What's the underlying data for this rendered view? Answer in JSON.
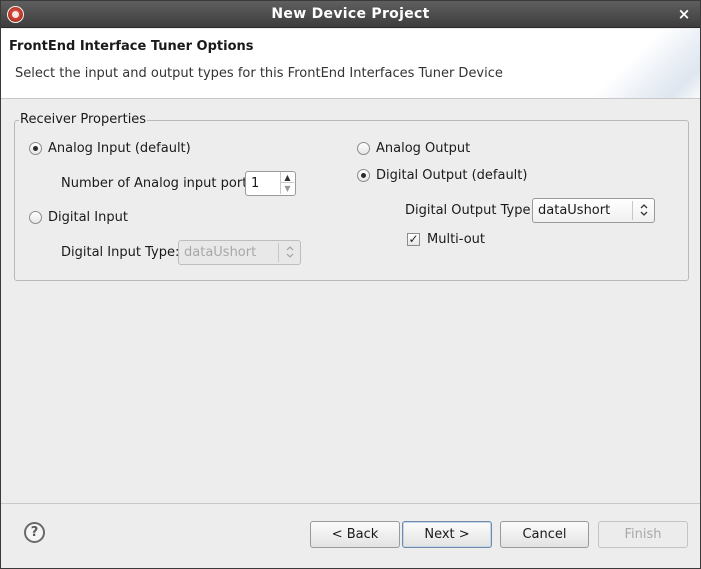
{
  "window": {
    "title": "New Device Project",
    "close_glyph": "×"
  },
  "banner": {
    "title": "FrontEnd Interface Tuner Options",
    "description": "Select the input and output types for this FrontEnd Interfaces Tuner Device"
  },
  "receiver": {
    "legend": "Receiver Properties",
    "analog_input": {
      "label": "Analog Input (default)",
      "selected": true
    },
    "num_analog_ports": {
      "label": "Number of Analog input ports:",
      "value": "1"
    },
    "digital_input": {
      "label": "Digital Input",
      "selected": false
    },
    "digital_input_type": {
      "label": "Digital Input Type:",
      "value": "dataUshort",
      "enabled": false
    },
    "analog_output": {
      "label": "Analog Output",
      "selected": false
    },
    "digital_output": {
      "label": "Digital Output (default)",
      "selected": true
    },
    "digital_output_type": {
      "label": "Digital Output Type:",
      "value": "dataUshort",
      "enabled": true
    },
    "multi_out": {
      "label": "Multi-out",
      "checked": true
    }
  },
  "footer": {
    "help_glyph": "?",
    "back_label": "< Back",
    "next_label": "Next >",
    "cancel_label": "Cancel",
    "finish_label": "Finish"
  },
  "icons": {
    "spin_up": "▲",
    "spin_down": "▼",
    "combo_arrows": "⌃⌄",
    "check": "✓"
  }
}
